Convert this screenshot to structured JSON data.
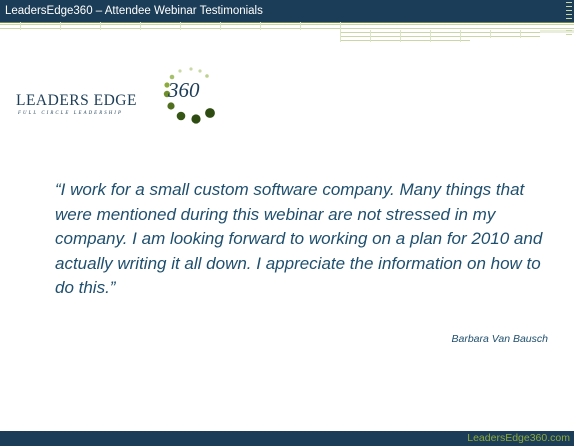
{
  "header": {
    "title": "LeadersEdge360 – Attendee Webinar Testimonials"
  },
  "logo": {
    "wordmark": "LEADERS EDGE",
    "number": "360",
    "tagline": "FULL CIRCLE LEADERSHIP"
  },
  "testimonial": {
    "quote": "“I work for a small custom software company.  Many things that were mentioned during this webinar are not stressed in my company.  I am looking forward to working on a plan for 2010 and actually writing it all down.  I appreciate the information on how to do this.”",
    "author": "Barbara Van Bausch"
  },
  "footer": {
    "text": "LeadersEdge360.com"
  },
  "colors": {
    "bar": "#1c3d57",
    "accent_green": "#8dab3b",
    "quote_text": "#1f4f6e"
  }
}
